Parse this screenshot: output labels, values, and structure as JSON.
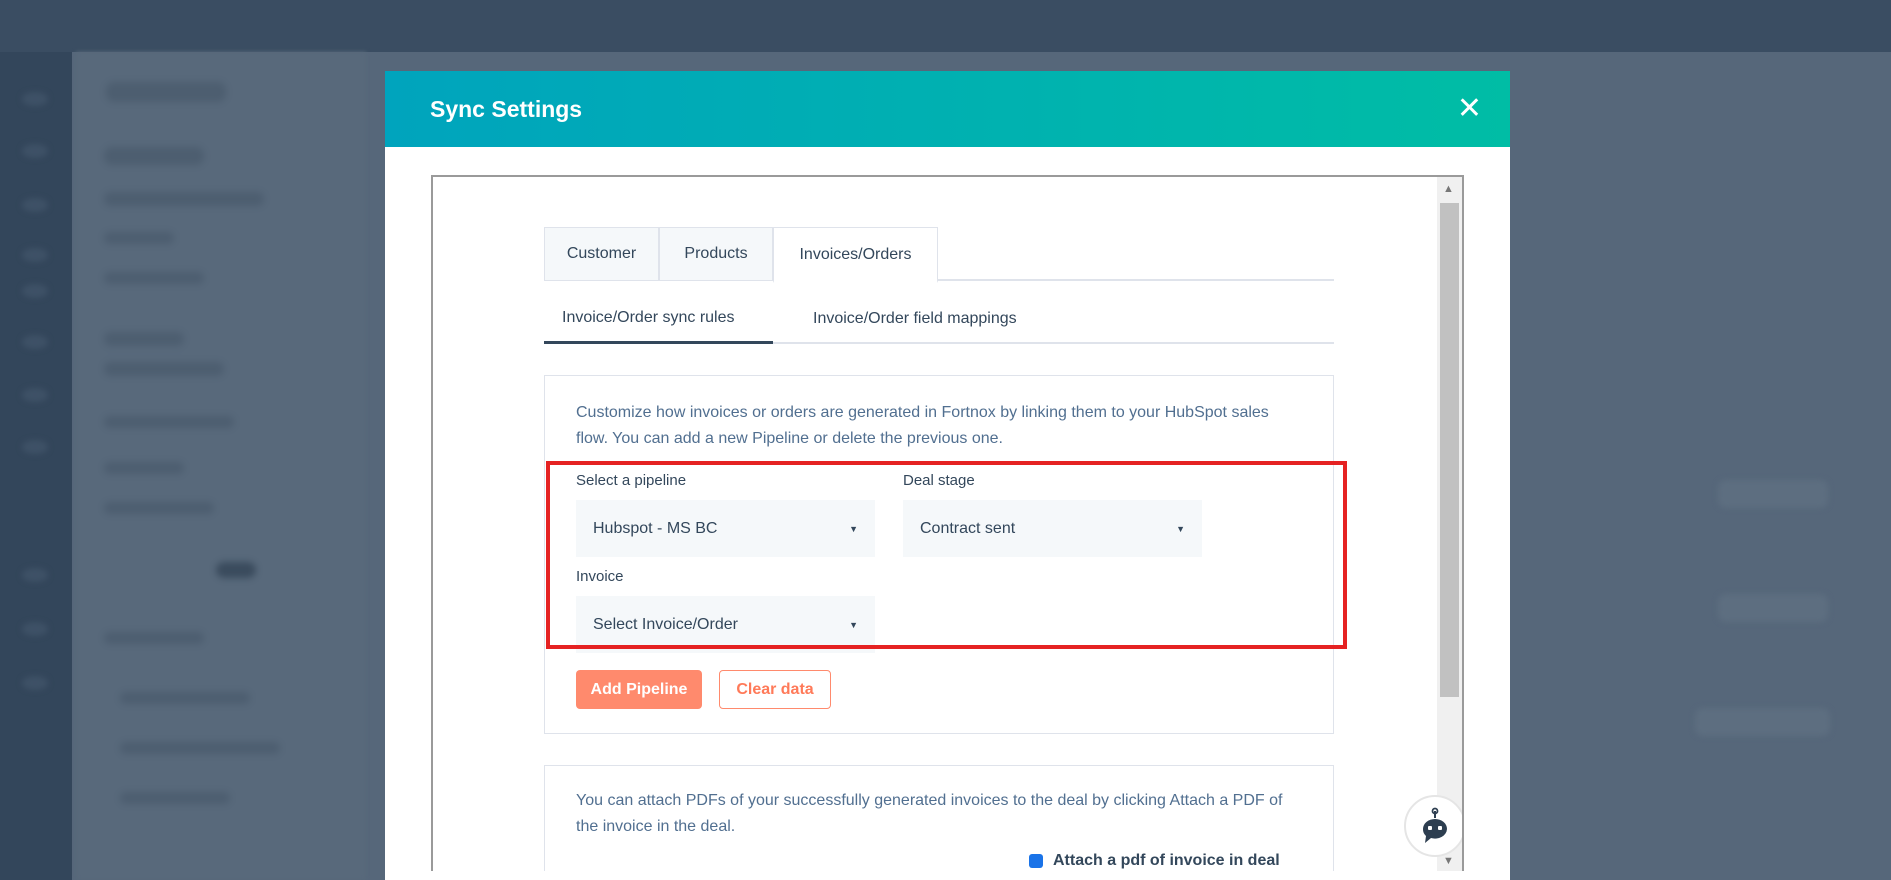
{
  "modal": {
    "title": "Sync Settings",
    "close_icon": "close-icon"
  },
  "tabs": [
    {
      "label": "Customer"
    },
    {
      "label": "Products"
    },
    {
      "label": "Invoices/Orders",
      "active": true
    }
  ],
  "subtabs": [
    {
      "label": "Invoice/Order sync rules",
      "active": true
    },
    {
      "label": "Invoice/Order field mappings"
    }
  ],
  "rules_card": {
    "description": "Customize how invoices or orders are generated in Fortnox by linking them to your HubSpot sales flow. You can add a new Pipeline or delete the previous one.",
    "pipeline": {
      "label": "Select a pipeline",
      "value": "Hubspot - MS BC"
    },
    "deal_stage": {
      "label": "Deal stage",
      "value": "Contract sent"
    },
    "invoice": {
      "label": "Invoice",
      "value": "Select Invoice/Order"
    },
    "add_button": "Add Pipeline",
    "clear_button": "Clear data"
  },
  "pdf_card": {
    "description": "You can attach PDFs of your successfully generated invoices to the deal by clicking Attach a PDF of the invoice in the deal.",
    "checkbox_label": "Attach a pdf of invoice in deal",
    "checkbox_checked": true
  },
  "colors": {
    "header_start": "#00a4bd",
    "header_end": "#00bda5",
    "primary_button": "#ff8a6d",
    "highlight": "#e52222"
  }
}
